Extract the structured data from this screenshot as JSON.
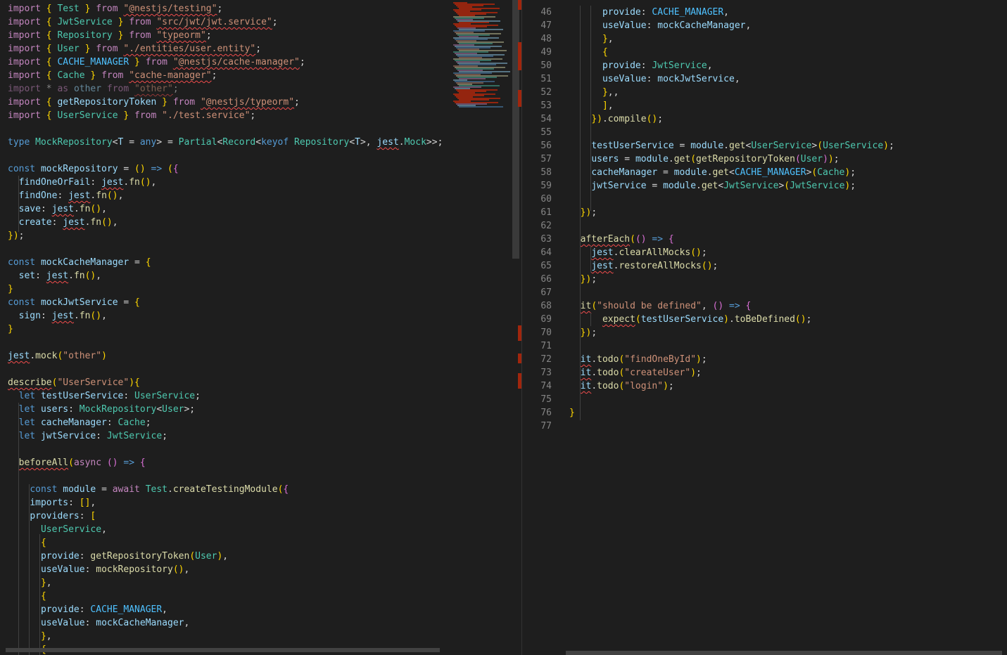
{
  "left_lines": [
    "import { Test } from \"@nestjs/testing\";",
    "import { JwtService } from \"src/jwt/jwt.service\";",
    "import { Repository } from \"typeorm\";",
    "import { User } from \"./entities/user.entity\";",
    "import { CACHE_MANAGER } from \"@nestjs/cache-manager\";",
    "import { Cache } from \"cache-manager\";",
    "import * as other from \"other\";",
    "import { getRepositoryToken } from \"@nestjs/typeorm\";",
    "import { UserService } from \"./test.service\";",
    "",
    "type MockRepository<T = any> = Partial<Record<keyof Repository<T>, jest.Mock>>;",
    "",
    "const mockRepository = () => ({",
    "  findOneOrFail: jest.fn(),",
    "  findOne: jest.fn(),",
    "  save: jest.fn(),",
    "  create: jest.fn(),",
    "});",
    "",
    "const mockCacheManager = {",
    "  set: jest.fn(),",
    "}",
    "const mockJwtService = {",
    "  sign: jest.fn(),",
    "}",
    "",
    "jest.mock(\"other\")",
    "",
    "describe(\"UserService\"){",
    "  let testUserService: UserService;",
    "  let users: MockRepository<User>;",
    "  let cacheManager: Cache;",
    "  let jwtService: JwtService;",
    "",
    "  beforeAll(async () => {",
    "",
    "    const module = await Test.createTestingModule({",
    "    imports: [],",
    "    providers: [",
    "      UserService,",
    "      {",
    "      provide: getRepositoryToken(User),",
    "      useValue: mockRepository(),",
    "      },",
    "      {",
    "      provide: CACHE_MANAGER,",
    "      useValue: mockCacheManager,",
    "      },",
    "      {"
  ],
  "right_lines": [
    {
      "n": "46",
      "text": "      provide: CACHE_MANAGER,"
    },
    {
      "n": "47",
      "text": "      useValue: mockCacheManager,"
    },
    {
      "n": "48",
      "text": "      },"
    },
    {
      "n": "49",
      "text": "      {"
    },
    {
      "n": "50",
      "text": "      provide: JwtService,"
    },
    {
      "n": "51",
      "text": "      useValue: mockJwtService,"
    },
    {
      "n": "52",
      "text": "      },,"
    },
    {
      "n": "53",
      "text": "      ],"
    },
    {
      "n": "54",
      "text": "    }).compile();"
    },
    {
      "n": "55",
      "text": ""
    },
    {
      "n": "56",
      "text": "    testUserService = module.get<UserService>(UserService);"
    },
    {
      "n": "57",
      "text": "    users = module.get(getRepositoryToken(User));"
    },
    {
      "n": "58",
      "text": "    cacheManager = module.get<CACHE_MANAGER>(Cache);"
    },
    {
      "n": "59",
      "text": "    jwtService = module.get<JwtService>(JwtService);"
    },
    {
      "n": "60",
      "text": ""
    },
    {
      "n": "61",
      "text": "  });"
    },
    {
      "n": "62",
      "text": ""
    },
    {
      "n": "63",
      "text": "  afterEach(() => {"
    },
    {
      "n": "64",
      "text": "    jest.clearAllMocks();"
    },
    {
      "n": "65",
      "text": "    jest.restoreAllMocks();"
    },
    {
      "n": "66",
      "text": "  });"
    },
    {
      "n": "67",
      "text": ""
    },
    {
      "n": "68",
      "text": "  it(\"should be defined\", () => {"
    },
    {
      "n": "69",
      "text": "      expect(testUserService).toBeDefined();"
    },
    {
      "n": "70",
      "text": "  });"
    },
    {
      "n": "71",
      "text": ""
    },
    {
      "n": "72",
      "text": "  it.todo(\"findOneById\");"
    },
    {
      "n": "73",
      "text": "  it.todo(\"createUser\");"
    },
    {
      "n": "74",
      "text": "  it.todo(\"login\");"
    },
    {
      "n": "75",
      "text": ""
    },
    {
      "n": "76",
      "text": "}"
    },
    {
      "n": "77",
      "text": ""
    }
  ],
  "colors": {
    "background": "#1e1e1e",
    "keyword": "#c586c0",
    "storage": "#569cd6",
    "string": "#ce9178",
    "function": "#dcdcaa",
    "variable": "#9cdcfe",
    "type": "#4ec9b0",
    "error": "#f14c4c"
  }
}
